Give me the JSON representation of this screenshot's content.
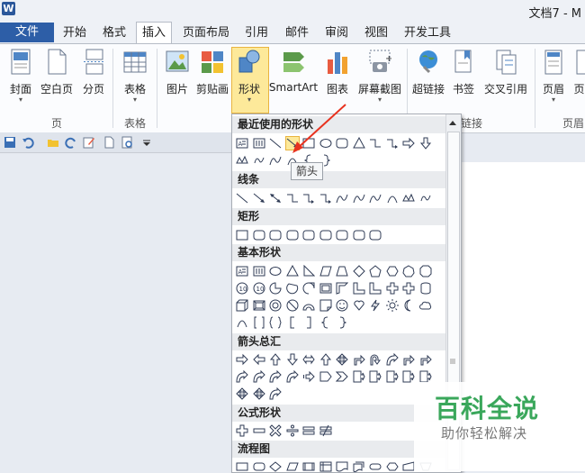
{
  "app": {
    "logo": "W",
    "title": "文档7 - M"
  },
  "tabs": [
    {
      "label": "文件"
    },
    {
      "label": "开始"
    },
    {
      "label": "格式"
    },
    {
      "label": "插入"
    },
    {
      "label": "页面布局"
    },
    {
      "label": "引用"
    },
    {
      "label": "邮件"
    },
    {
      "label": "审阅"
    },
    {
      "label": "视图"
    },
    {
      "label": "开发工具"
    }
  ],
  "active_tab": "插入",
  "ribbon": {
    "buttons": [
      {
        "label": "封面",
        "arrow": "▾"
      },
      {
        "label": "空白页"
      },
      {
        "label": "分页"
      },
      {
        "label": "表格",
        "arrow": "▾"
      },
      {
        "label": "图片"
      },
      {
        "label": "剪贴画"
      },
      {
        "label": "形状",
        "arrow": "▾"
      },
      {
        "label": "SmartArt"
      },
      {
        "label": "图表"
      },
      {
        "label": "屏幕截图",
        "arrow": "▾"
      },
      {
        "label": "超链接"
      },
      {
        "label": "书签"
      },
      {
        "label": "交叉引用"
      },
      {
        "label": "页眉",
        "arrow": "▾"
      },
      {
        "label": "页"
      }
    ],
    "groups": [
      "页",
      "表格",
      "链接",
      "页眉"
    ]
  },
  "shapes_menu": {
    "sections": [
      "最近使用的形状",
      "线条",
      "矩形",
      "基本形状",
      "箭头总汇",
      "公式形状",
      "流程图"
    ],
    "tooltip": "箭头"
  },
  "watermark": {
    "title": "百科全说",
    "subtitle": "助你轻松解决"
  },
  "colors": {
    "file_tab": "#2d5ea7",
    "highlight": "#fde99a",
    "shape_stroke": "#2f3b55",
    "annotation_arrow": "#e8321f",
    "watermark_green": "#3aa75b"
  }
}
